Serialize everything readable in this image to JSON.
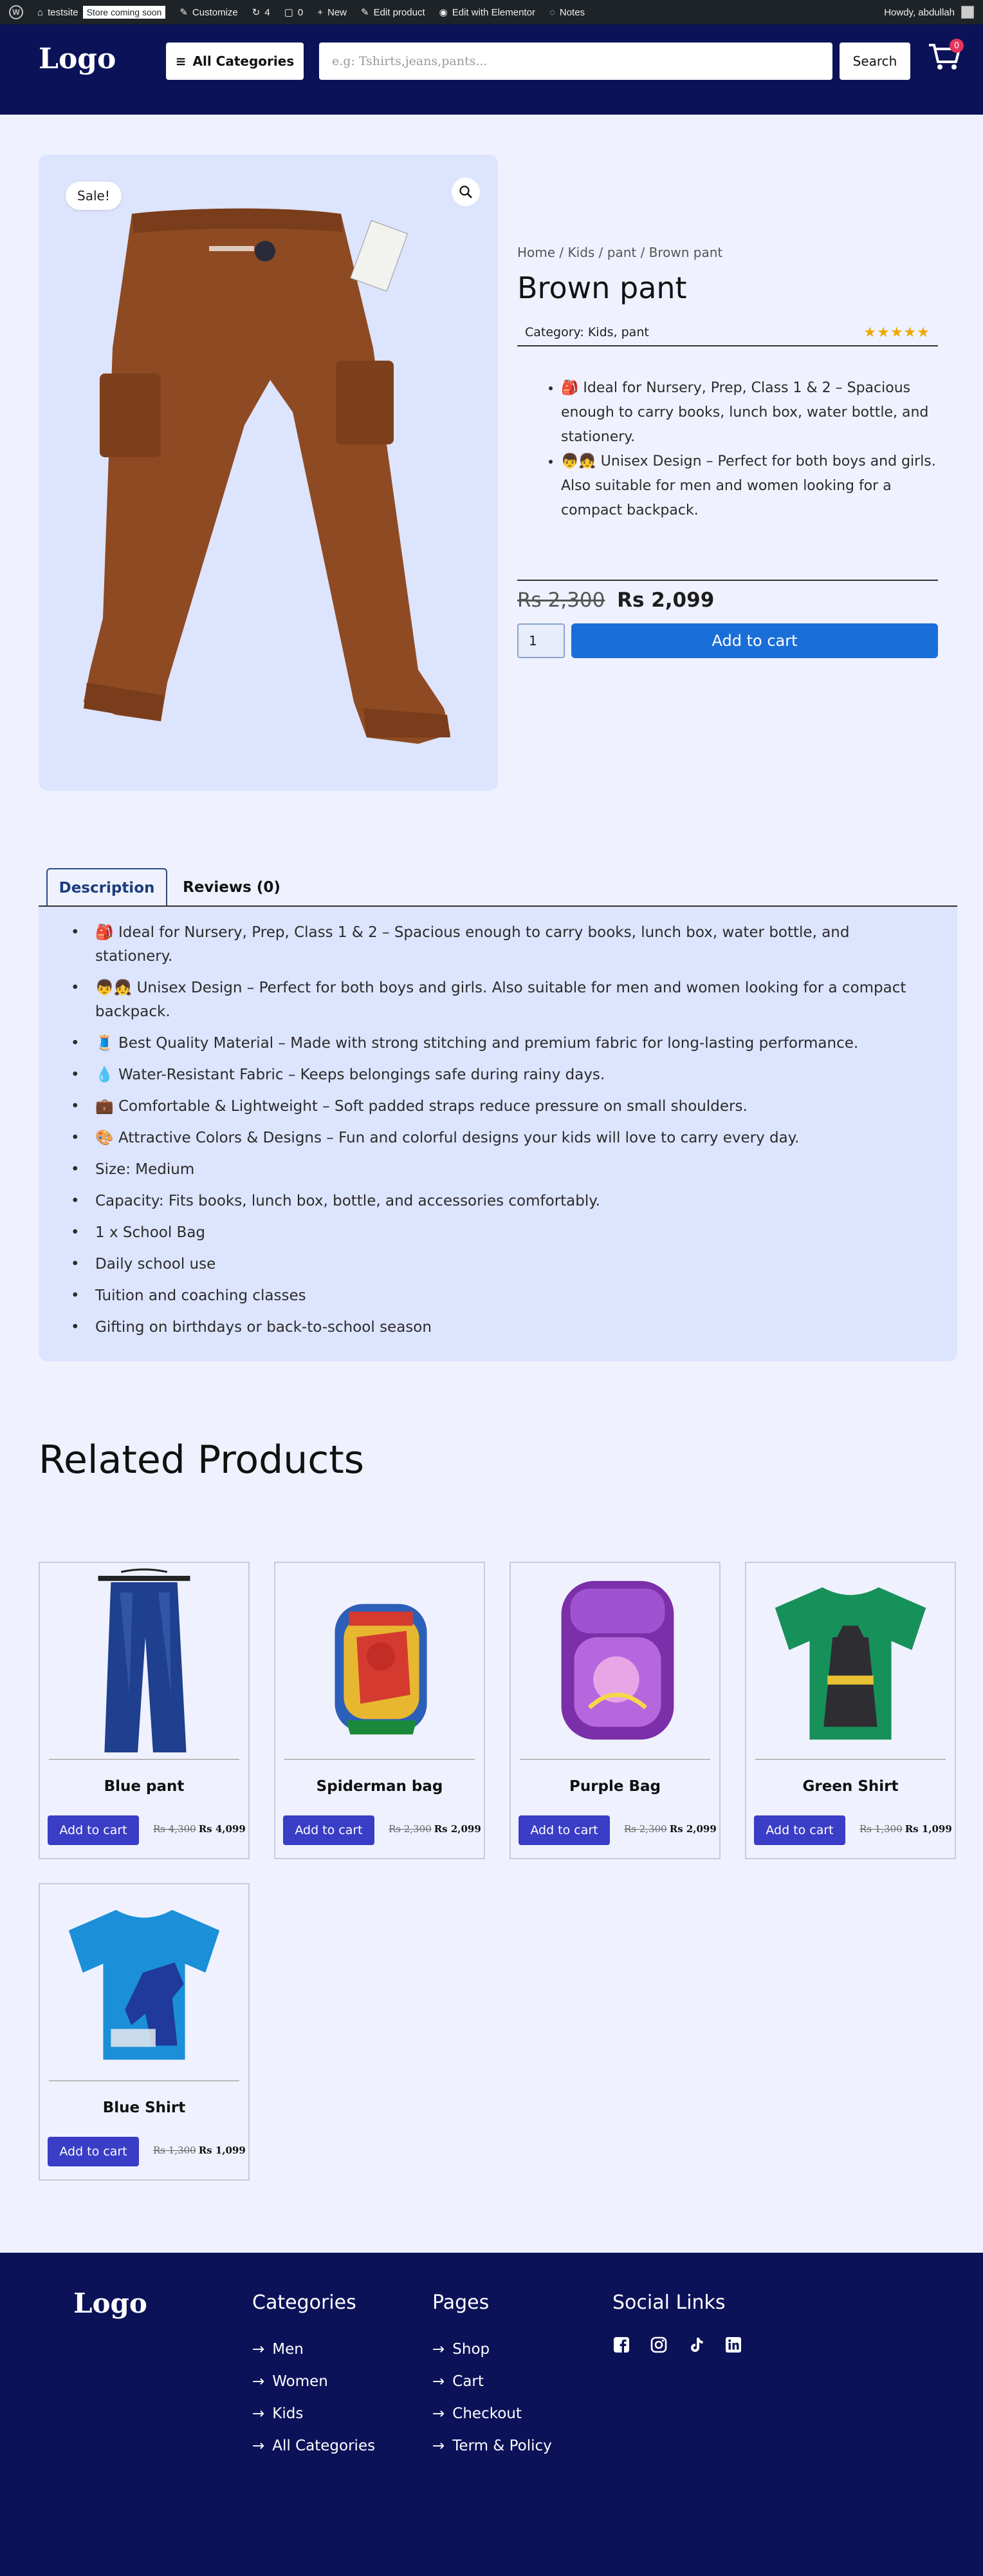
{
  "adminbar": {
    "site": "testsite",
    "badge": "Store coming soon",
    "customize": "Customize",
    "updates": "4",
    "comments": "0",
    "new": "New",
    "edit_product": "Edit product",
    "elementor": "Edit with Elementor",
    "notes": "Notes",
    "howdy": "Howdy, abdullah"
  },
  "header": {
    "logo": "Logo",
    "all_categories": "All Categories",
    "search_placeholder": "e.g: Tshirts,jeans,pants...",
    "search_button": "Search",
    "cart_count": "0"
  },
  "product": {
    "sale_badge": "Sale!",
    "breadcrumb": "Home / Kids / pant / Brown pant",
    "title": "Brown pant",
    "category": "Category: Kids, pant",
    "rating": "★★★★★",
    "bullets": [
      "🎒 Ideal for Nursery, Prep, Class 1 & 2 – Spacious enough to carry books, lunch box, water bottle, and stationery.",
      "👦👧 Unisex Design – Perfect for both boys and girls. Also suitable for men and women looking for a compact backpack."
    ],
    "old_price": "Rs 2,300",
    "price": "Rs 2,099",
    "qty": "1",
    "add_to_cart": "Add to cart"
  },
  "tabs": {
    "description": "Description",
    "reviews": "Reviews (0)"
  },
  "description": [
    "🎒 Ideal for Nursery, Prep, Class 1 & 2 – Spacious enough to carry books, lunch box, water bottle, and stationery.",
    "👦👧 Unisex Design – Perfect for both boys and girls. Also suitable for men and women looking for a compact backpack.",
    "🧵 Best Quality Material – Made with strong stitching and premium fabric for long-lasting performance.",
    "💧 Water-Resistant Fabric – Keeps belongings safe during rainy days.",
    "💼 Comfortable & Lightweight – Soft padded straps reduce pressure on small shoulders.",
    "🎨 Attractive Colors & Designs – Fun and colorful designs your kids will love to carry every day.",
    "Size: Medium",
    "Capacity: Fits books, lunch box, bottle, and accessories comfortably.",
    "1 x School Bag",
    "Daily school use",
    "Tuition and coaching classes",
    "Gifting on birthdays or back-to-school season"
  ],
  "related": {
    "title": "Related Products",
    "button": "Add to cart",
    "items": [
      {
        "name": "Blue pant",
        "old": "Rs 4,300",
        "price": "Rs 4,099"
      },
      {
        "name": "Spiderman bag",
        "old": "Rs 2,300",
        "price": "Rs 2,099"
      },
      {
        "name": "Purple Bag",
        "old": "Rs 2,300",
        "price": "Rs 2,099"
      },
      {
        "name": "Green Shirt",
        "old": "Rs 1,300",
        "price": "Rs 1,099"
      },
      {
        "name": "Blue Shirt",
        "old": "Rs 1,300",
        "price": "Rs 1,099"
      }
    ]
  },
  "footer": {
    "logo": "Logo",
    "categories_title": "Categories",
    "categories": [
      "Men",
      "Women",
      "Kids",
      "All Categories"
    ],
    "pages_title": "Pages",
    "pages": [
      "Shop",
      "Cart",
      "Checkout",
      "Term & Policy"
    ],
    "social_title": "Social Links",
    "social_icons": [
      "facebook-icon",
      "instagram-icon",
      "tiktok-icon",
      "linkedin-icon"
    ]
  },
  "colors": {
    "navy": "#0b1258",
    "page_bg": "#eff2fe",
    "panel_bg": "#dde4fd",
    "primary_button": "#1a6ed8",
    "card_button": "#3a3dc6",
    "cart_badge": "#e6335a",
    "stars": "#f0a800"
  }
}
